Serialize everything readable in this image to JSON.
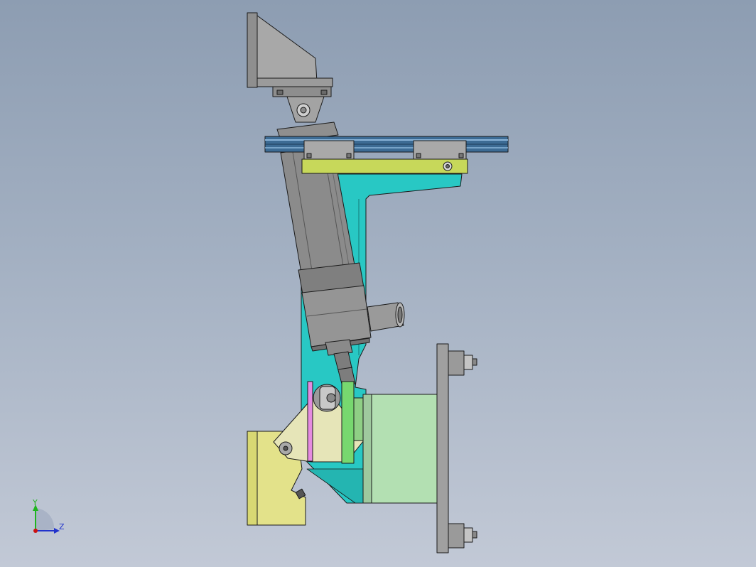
{
  "triad": {
    "y_label": "Y",
    "z_label": "Z"
  },
  "colors": {
    "background_top": "#8d9db2",
    "background_bottom": "#c2c9d6",
    "steel_gray": "#a6a6a6",
    "dark_steel": "#6f6f6f",
    "teal_plate": "#28c8c4",
    "yellow_green_plate": "#c7d85a",
    "light_yellow": "#e3e28a",
    "cream_link": "#e6e5b8",
    "light_green_box": "#b3e0b2",
    "green_pad": "#77d86f",
    "pink_pad": "#e58be0",
    "blue_rail": "#2f5d86",
    "axis_y": "#1fb51f",
    "axis_z": "#2233cc",
    "origin": "#cc1111"
  }
}
